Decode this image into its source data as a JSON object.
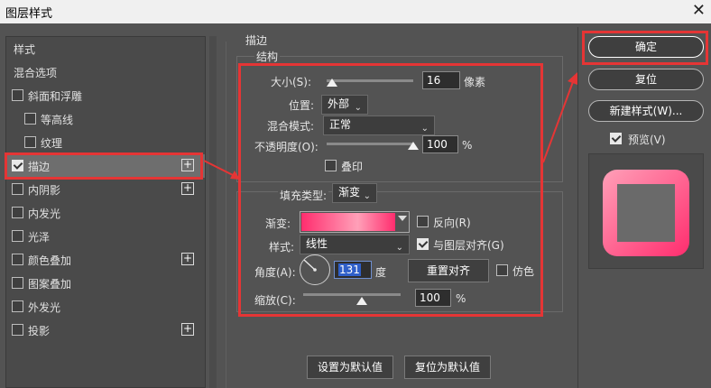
{
  "window": {
    "title": "图层样式"
  },
  "stylelist": {
    "header": "样式",
    "blend_options": "混合选项",
    "items": [
      {
        "label": "斜面和浮雕",
        "checked": false,
        "plus": false,
        "indent": false
      },
      {
        "label": "等高线",
        "checked": false,
        "plus": false,
        "indent": true
      },
      {
        "label": "纹理",
        "checked": false,
        "plus": false,
        "indent": true
      },
      {
        "label": "描边",
        "checked": true,
        "plus": true,
        "indent": false,
        "selected": true
      },
      {
        "label": "内阴影",
        "checked": false,
        "plus": true,
        "indent": false
      },
      {
        "label": "内发光",
        "checked": false,
        "plus": false,
        "indent": false
      },
      {
        "label": "光泽",
        "checked": false,
        "plus": false,
        "indent": false
      },
      {
        "label": "颜色叠加",
        "checked": false,
        "plus": true,
        "indent": false
      },
      {
        "label": "图案叠加",
        "checked": false,
        "plus": false,
        "indent": false
      },
      {
        "label": "外发光",
        "checked": false,
        "plus": false,
        "indent": false
      },
      {
        "label": "投影",
        "checked": false,
        "plus": true,
        "indent": false
      }
    ]
  },
  "stroke": {
    "section_title": "描边",
    "structure_title": "结构",
    "size_label": "大小(S):",
    "size_value": "16",
    "size_unit": "像素",
    "size_fraction": 0.06,
    "position_label": "位置:",
    "position_value": "外部",
    "blend_label": "混合模式:",
    "blend_value": "正常",
    "opacity_label": "不透明度(O):",
    "opacity_value": "100",
    "opacity_unit": "%",
    "opacity_fraction": 1.0,
    "overprint_label": "叠印",
    "fill_type_label": "填充类型:",
    "fill_type_value": "渐变",
    "gradient_label": "渐变:",
    "reverse_label": "反向(R)",
    "style_label": "样式:",
    "style_value": "线性",
    "align_label": "与图层对齐(G)",
    "angle_label": "角度(A):",
    "angle_value": "131",
    "angle_unit": "度",
    "reset_align_label": "重置对齐",
    "dither_label": "仿色",
    "scale_label": "缩放(C):",
    "scale_value": "100",
    "scale_unit": "%",
    "scale_fraction": 0.6
  },
  "bottom": {
    "set_default": "设置为默认值",
    "reset_default": "复位为默认值"
  },
  "right": {
    "ok": "确定",
    "reset": "复位",
    "new_style": "新建样式(W)...",
    "preview_label": "预览(V)"
  },
  "colors": {
    "highlight_red": "#e53535",
    "gradient_start": "#ff2d6e",
    "gradient_end": "#ffa0b8",
    "preview_bg": "#4a4a4a"
  }
}
